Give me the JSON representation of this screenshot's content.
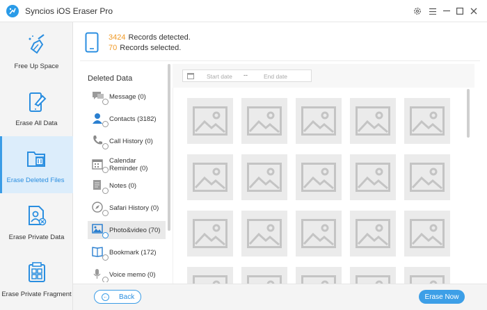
{
  "window": {
    "title": "Syncios iOS Eraser Pro"
  },
  "sidebar": {
    "items": [
      {
        "label": "Free Up Space"
      },
      {
        "label": "Erase All Data"
      },
      {
        "label": "Erase Deleted Files"
      },
      {
        "label": "Erase Private Data"
      },
      {
        "label": "Erase Private Fragment"
      }
    ],
    "active_index": 2
  },
  "summary": {
    "detected_count": "3424",
    "detected_label": "Records detected.",
    "selected_count": "70",
    "selected_label": "Records selected."
  },
  "categories": {
    "title": "Deleted Data",
    "items": [
      {
        "label": "Message (0)"
      },
      {
        "label": "Contacts (3182)"
      },
      {
        "label": "Call History (0)"
      },
      {
        "label": "Calendar",
        "label2": "Reminder (0)"
      },
      {
        "label": "Notes (0)"
      },
      {
        "label": "Safari History (0)"
      },
      {
        "label": "Photo&video (70)"
      },
      {
        "label": "Bookmark (172)"
      },
      {
        "label": "Voice memo (0)"
      }
    ],
    "selected_index": 6
  },
  "filter": {
    "start_placeholder": "Start date",
    "separator": "--",
    "end_placeholder": "End date"
  },
  "footer": {
    "back_label": "Back",
    "erase_label": "Erase Now"
  },
  "colors": {
    "accent": "#3d9fe7",
    "count": "#f09a27",
    "sidebar_active": "#dcedfb"
  }
}
